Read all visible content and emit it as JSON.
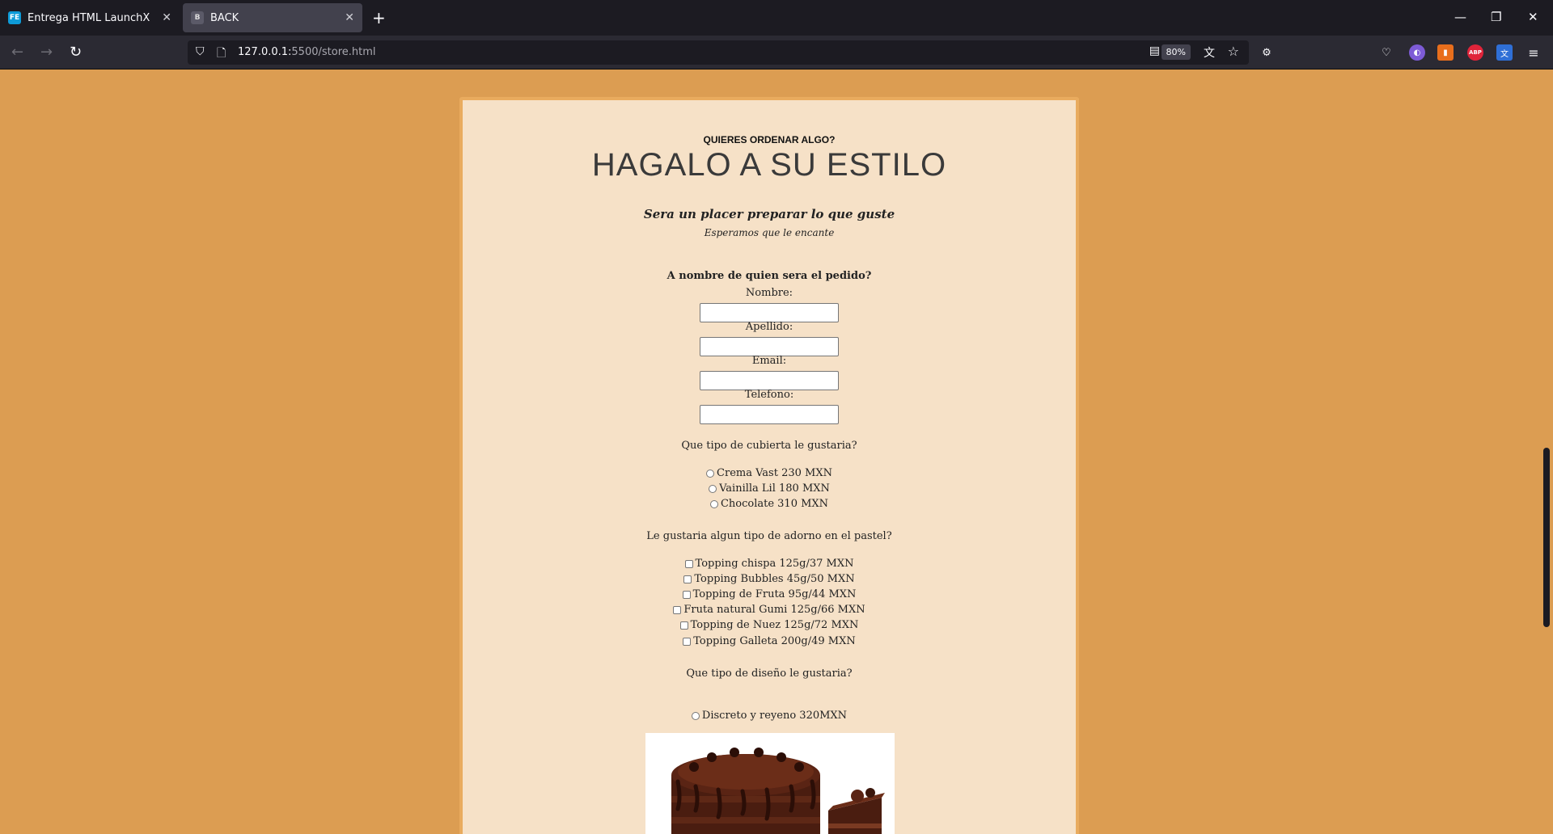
{
  "browser": {
    "tabs": [
      {
        "title": "Entrega HTML LaunchX",
        "icon": "FE",
        "active": false
      },
      {
        "title": "BACK",
        "icon": "B",
        "active": true
      }
    ],
    "url_host": "127.0.0.1:",
    "url_path": "5500/store.html",
    "zoom": "80%"
  },
  "page": {
    "kicker": "QUIERES ORDENAR ALGO?",
    "headline": "HAGALO A SU ESTILO",
    "lead": "Sera un placer preparar lo que guste",
    "sublead": "Esperamos que le encante",
    "name_question": "A nombre de quien sera el pedido?",
    "fields": [
      {
        "label": "Nombre:",
        "value": ""
      },
      {
        "label": "Apellido:",
        "value": ""
      },
      {
        "label": "Email:",
        "value": ""
      },
      {
        "label": "Telefono:",
        "value": ""
      }
    ],
    "cover_question": "Que tipo de cubierta le gustaria?",
    "cover_options": [
      "Crema Vast 230 MXN",
      "Vainilla Lil 180 MXN",
      "Chocolate 310 MXN"
    ],
    "topping_question": "Le gustaria algun tipo de adorno en el pastel?",
    "topping_options": [
      "Topping chispa 125g/37 MXN",
      "Topping Bubbles 45g/50 MXN",
      "Topping de Fruta 95g/44 MXN",
      "Fruta natural Gumi 125g/66 MXN",
      "Topping de Nuez 125g/72 MXN",
      "Topping Galleta 200g/49 MXN"
    ],
    "design_question": "Que tipo de diseño le gustaria?",
    "design_options": [
      "Discreto y reyeno 320MXN"
    ]
  },
  "colors": {
    "page_bg": "#dc9d52",
    "card_bg": "#f6e1c7",
    "card_border": "#e9ab5e",
    "browser_dark": "#1c1b22"
  }
}
